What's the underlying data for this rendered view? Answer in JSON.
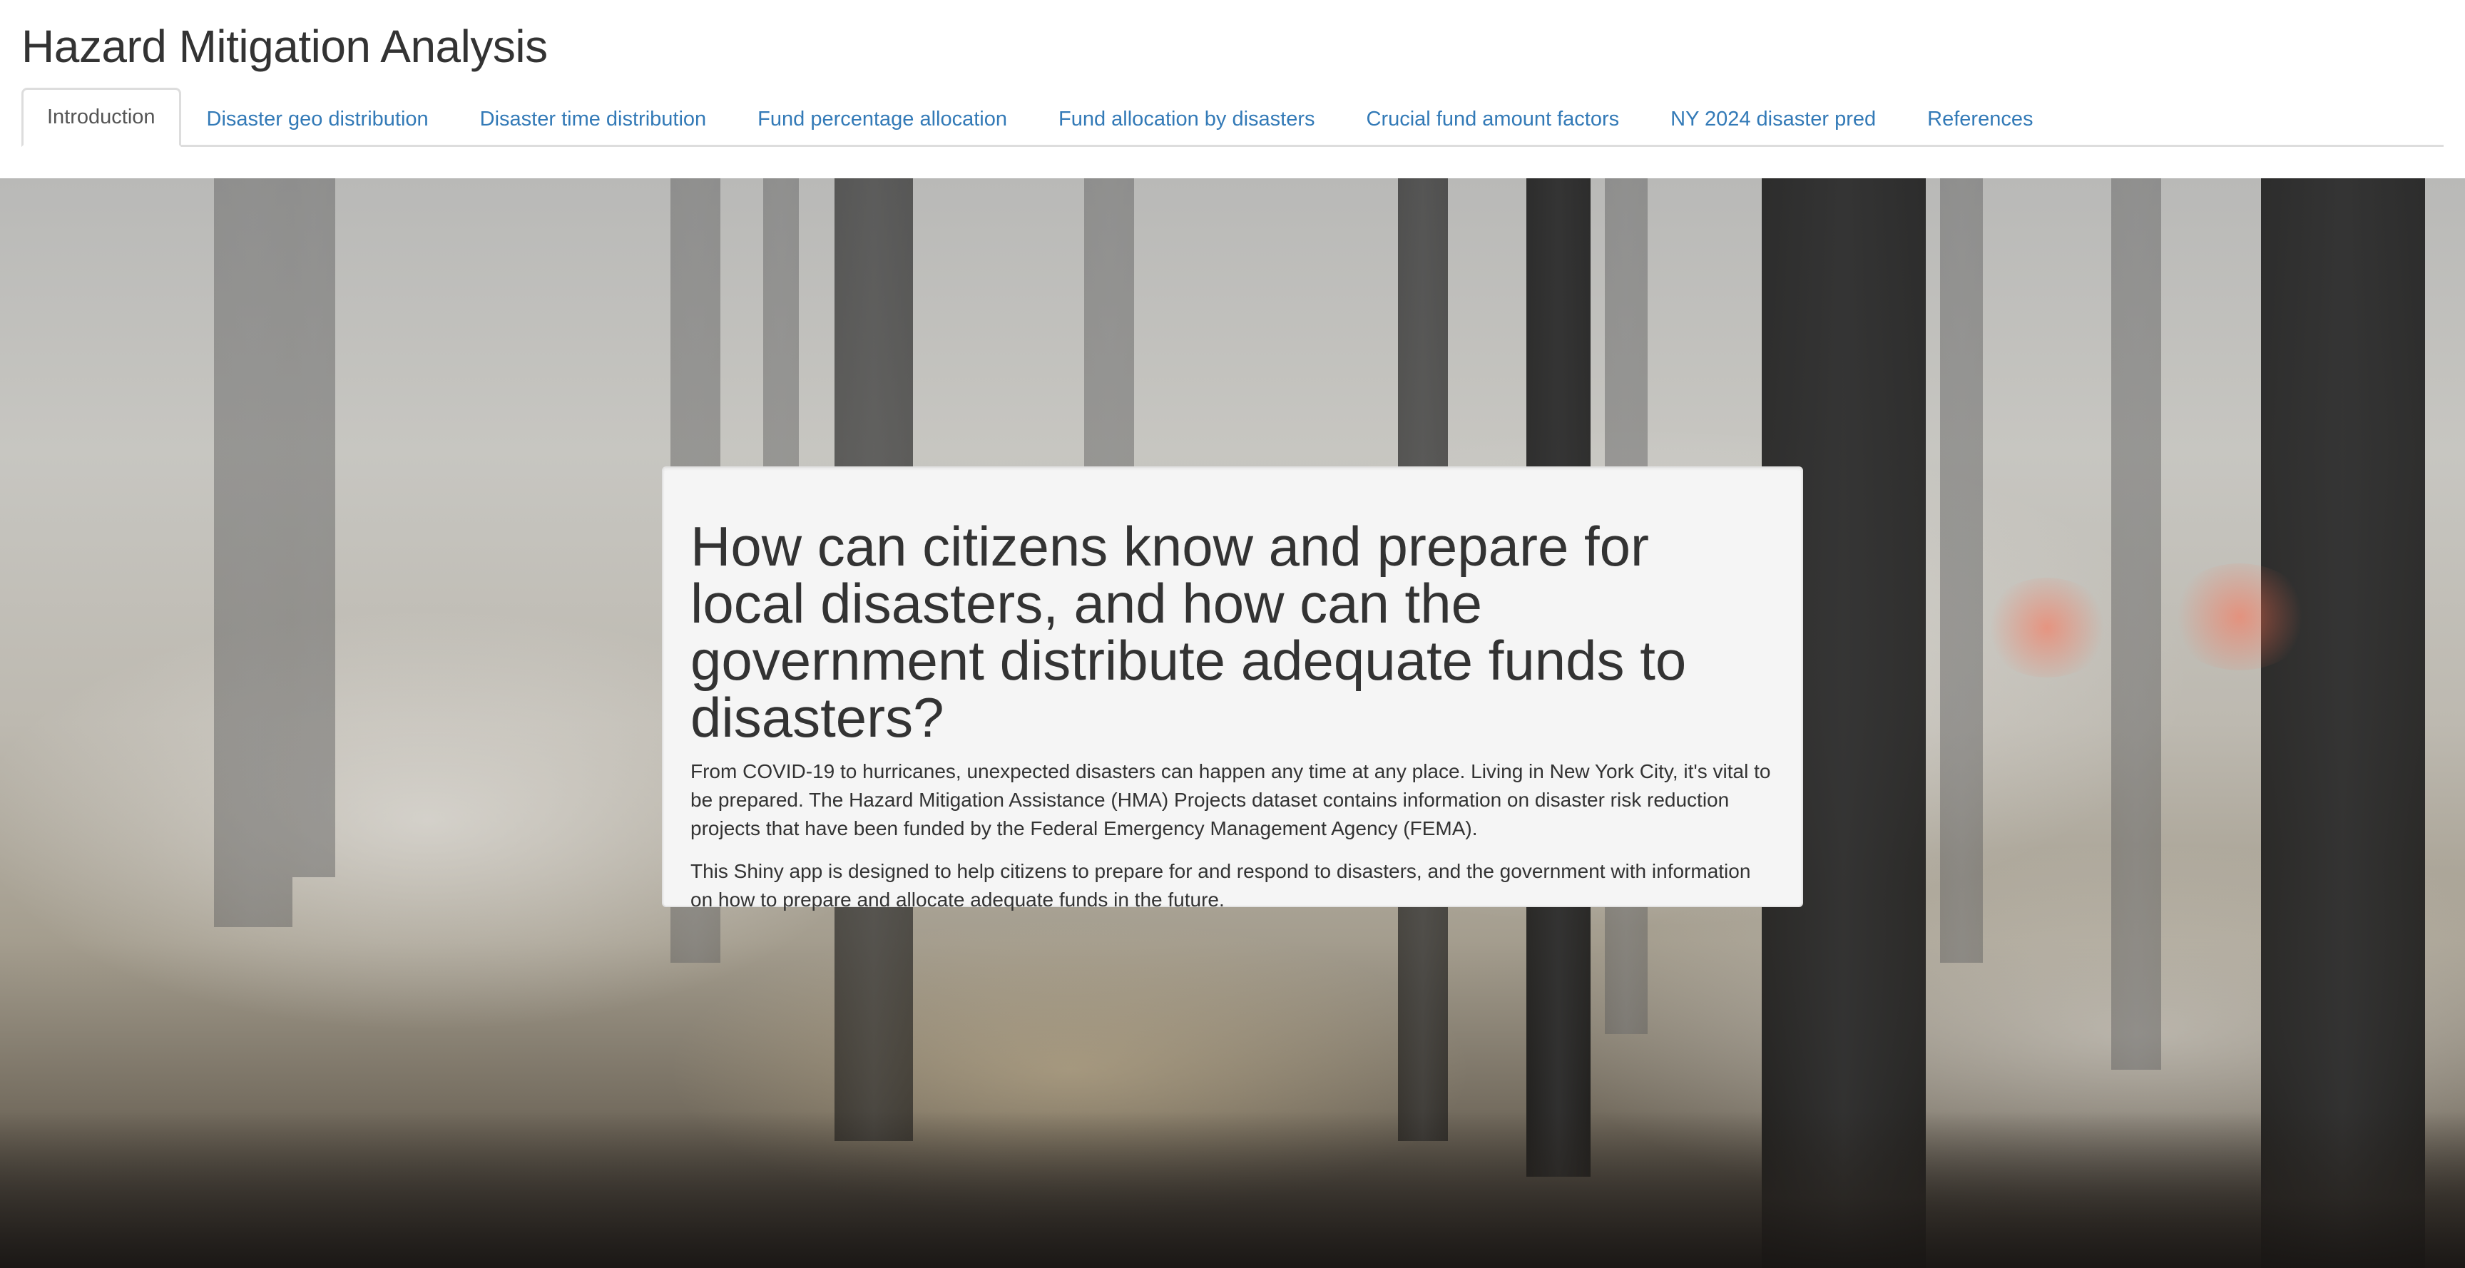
{
  "app": {
    "title": "Hazard Mitigation Analysis"
  },
  "tabs": [
    {
      "label": "Introduction",
      "active": true
    },
    {
      "label": "Disaster geo distribution",
      "active": false
    },
    {
      "label": "Disaster time distribution",
      "active": false
    },
    {
      "label": "Fund percentage allocation",
      "active": false
    },
    {
      "label": "Fund allocation by disasters",
      "active": false
    },
    {
      "label": "Crucial fund amount factors",
      "active": false
    },
    {
      "label": "NY 2024 disaster pred",
      "active": false
    },
    {
      "label": "References",
      "active": false
    }
  ],
  "intro": {
    "heading": "How can citizens know and prepare for local disasters, and how can the government distribute adequate funds to disasters?",
    "paragraph_1": "From COVID-19 to hurricanes, unexpected disasters can happen any time at any place. Living in New York City, it's vital to be prepared. The Hazard Mitigation Assistance (HMA) Projects dataset contains information on disaster risk reduction projects that have been funded by the Federal Emergency Management Agency (FEMA).",
    "paragraph_2": "This Shiny app is designed to help citizens to prepare for and respond to disasters, and the government with information on how to prepare and allocate adequate funds in the future."
  },
  "colors": {
    "link": "#337ab7",
    "active_tab_text": "#555555",
    "panel_background": "#f5f5f5",
    "text": "#333333"
  }
}
